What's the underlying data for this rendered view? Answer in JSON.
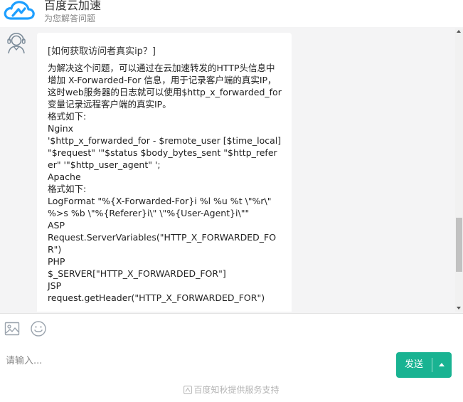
{
  "header": {
    "title": "百度云加速",
    "subtitle": "为您解答问题",
    "brand_color": "#1e9fff"
  },
  "chat": {
    "messages": [
      {
        "sender": "bot",
        "question": "[如何获取访问者真实ip？]",
        "answer_lines": [
          "为解决这个问题，可以通过在云加速转发的HTTP头信息中增加 X-Forwarded-For 信息，用于记录客户端的真实IP，这时web服务器的日志就可以使用$http_x_forwarded_for变量记录远程客户端的真实IP。",
          "格式如下:",
          "Nginx",
          "'$http_x_forwarded_for - $remote_user [$time_local] \"$request\" '\"$status $body_bytes_sent \"$http_referer\" '\"$http_user_agent\" ';",
          "Apache",
          "格式如下:",
          "LogFormat \"%{X-Forwarded-For}i %l %u %t \\\"%r\\\" %>s %b \\\"%{Referer}i\\\" \\\"%{User-Agent}i\\\"\"",
          "ASP",
          "Request.ServerVariables(\"HTTP_X_FORWARDED_FOR\")",
          "PHP",
          "$_SERVER[\"HTTP_X_FORWARDED_FOR\"]",
          "JSP",
          "request.getHeader(\"HTTP_X_FORWARDED_FOR\")"
        ]
      }
    ]
  },
  "composer": {
    "placeholder": "请输入...",
    "image_tool_icon": "image-icon",
    "emoji_tool_icon": "emoji-icon",
    "send_label": "发送",
    "send_color": "#19b392"
  },
  "footer": {
    "text": "百度知秋提供服务支持"
  }
}
